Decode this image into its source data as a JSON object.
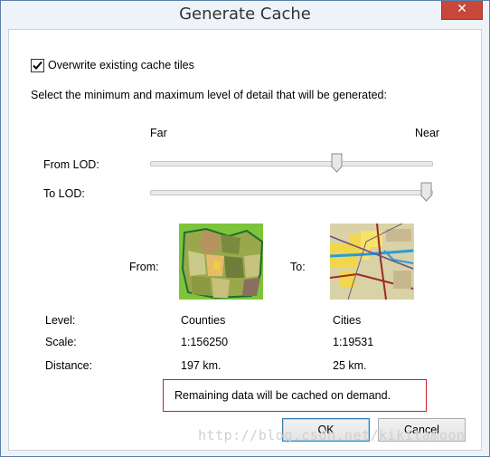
{
  "window": {
    "title": "Generate Cache",
    "close_glyph": "✕"
  },
  "overwrite": {
    "label": "Overwrite existing cache tiles",
    "checked": true
  },
  "instruction": "Select the minimum and maximum level of detail that will be generated:",
  "slider_scale": {
    "far": "Far",
    "near": "Near"
  },
  "from_lod": {
    "label": "From LOD:",
    "level_fraction": 0.67
  },
  "to_lod": {
    "label": "To LOD:",
    "level_fraction": 1.0
  },
  "preview": {
    "from_label": "From:",
    "to_label": "To:",
    "from_icon": "counties-map-thumbnail",
    "to_icon": "cities-map-thumbnail"
  },
  "info": {
    "labels": {
      "level": "Level:",
      "scale": "Scale:",
      "distance": "Distance:"
    },
    "from": {
      "level": "Counties",
      "scale": "1:156250",
      "distance": "197 km."
    },
    "to": {
      "level": "Cities",
      "scale": "1:19531",
      "distance": "25 km."
    }
  },
  "message": "Remaining data will be cached on demand.",
  "buttons": {
    "ok": "OK",
    "cancel": "Cancel"
  },
  "watermark": "http://blog.csdn.net/kikitamoon",
  "colors": {
    "message_border": "#c7212b",
    "close_button": "#c7473a",
    "dialog_border": "#5a7fa8"
  }
}
